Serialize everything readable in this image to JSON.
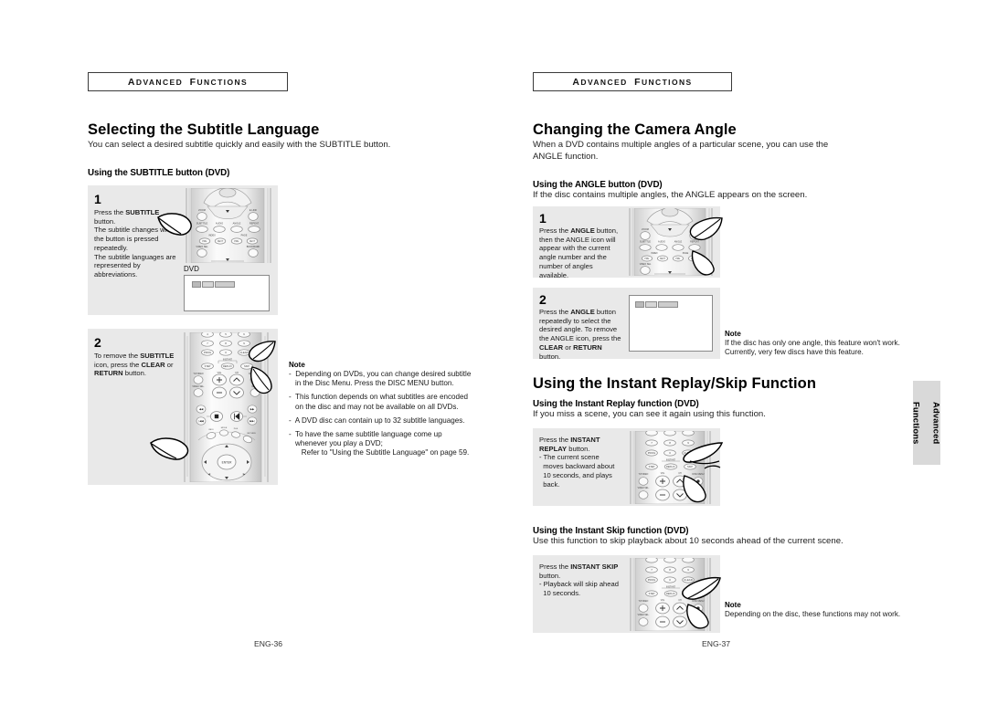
{
  "document": {
    "type": "dvd-player-user-manual",
    "spread": "two-page"
  },
  "left_page": {
    "chapter_tag": "ADVANCED FUNCTIONS",
    "title": "Selecting the Subtitle Language",
    "intro": "You can select a desired subtitle quickly and easily with the SUBTITLE button.",
    "subheading": "Using the SUBTITLE button (DVD)",
    "steps": [
      {
        "number": "1",
        "lines": [
          "Press the SUBTITLE",
          "button.",
          "The subtitle changes when",
          "the button is pressed",
          "repeatedly.",
          "The subtitle languages are",
          "represented by",
          "abbreviations."
        ],
        "screen_label": "DVD"
      },
      {
        "number": "2",
        "lines": [
          "To remove the SUBTITLE",
          "icon, press the CLEAR or",
          "RETURN button."
        ]
      }
    ],
    "note": {
      "title": "Note",
      "items": [
        "Depending on DVDs, you can change desired subtitle in the Disc Menu. Press the DISC MENU button.",
        "This function depends on what subtitles are encoded on the disc and may not be available on all DVDs.",
        "A DVD disc can contain up to 32 subtitle languages.",
        "To have the same subtitle language come up whenever you play a DVD; Refer to \"Using the Subtitle Language\" on page 59."
      ]
    },
    "folio": "ENG-36"
  },
  "right_page": {
    "chapter_tag": "ADVANCED FUNCTIONS",
    "section_camera_angle": {
      "title": "Changing the Camera Angle",
      "intro": "When a DVD contains multiple angles of a particular scene, you can use the ANGLE function.",
      "subheading": "Using the ANGLE button (DVD)",
      "sub_desc": "If the disc contains multiple angles, the ANGLE appears on the screen.",
      "steps": [
        {
          "number": "1",
          "lines": [
            "Press the ANGLE button,",
            "then the ANGLE icon will",
            "appear with the current",
            "angle number and the",
            "number of angles",
            "available."
          ]
        },
        {
          "number": "2",
          "lines": [
            "Press the ANGLE button",
            "repeatedly to select the",
            "desired angle. To remove",
            "the ANGLE icon, press the",
            "CLEAR or RETURN",
            "button."
          ]
        }
      ],
      "note": {
        "title": "Note",
        "body": "If the disc has only one angle, this feature won't work. Currently, very few discs have this feature."
      }
    },
    "section_instant": {
      "title": "Using the Instant Replay/Skip Function",
      "replay": {
        "subheading": "Using the Instant Replay function (DVD)",
        "sub_desc": "If you miss a scene, you can see it again using this function.",
        "lines": [
          "Press the INSTANT",
          "REPLAY button.",
          "- The current scene",
          "moves backward about",
          "10 seconds, and plays",
          "back."
        ]
      },
      "skip": {
        "subheading": "Using the Instant Skip function (DVD)",
        "sub_desc": "Use this function to skip playback about 10 seconds ahead of the current scene.",
        "lines": [
          "Press the INSTANT SKIP",
          "button.",
          "- Playback will skip ahead",
          "10 seconds."
        ],
        "note": {
          "title": "Note",
          "body": "Depending on the disc, these functions may not work."
        }
      }
    },
    "folio": "ENG-37"
  },
  "side_tab": {
    "line1": "Advanced",
    "line2": "Functions"
  },
  "colors": {
    "page_background": "#ffffff",
    "step_box_background": "#e9e9e9",
    "side_tab_background": "#d9d9d9",
    "text": "#000000",
    "rule": "#3a3a3a"
  }
}
